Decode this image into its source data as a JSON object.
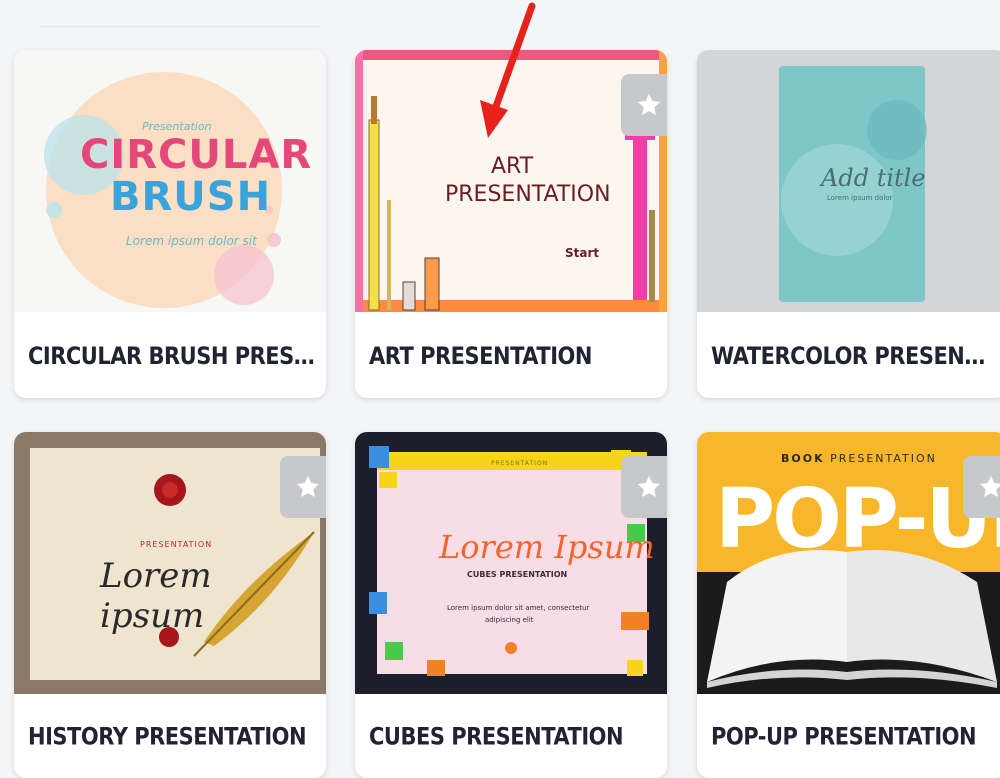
{
  "templates": [
    {
      "title": "CIRCULAR BRUSH PRESENTATI...",
      "favorite": false,
      "thumb": {
        "kicker": "Presentation",
        "line1": "CIRCULAR",
        "line2": "BRUSH",
        "sub": "Lorem ipsum dolor sit"
      }
    },
    {
      "title": "ART PRESENTATION",
      "favorite": true,
      "thumb": {
        "line1": "ART",
        "line2": "PRESENTATION",
        "start": "Start"
      }
    },
    {
      "title": "WATERCOLOR PRESENTATION II",
      "favorite": false,
      "thumb": {
        "heading": "Add title",
        "sub": "Lorem ipsum dolor"
      }
    },
    {
      "title": "HISTORY PRESENTATION",
      "favorite": true,
      "thumb": {
        "kicker": "PRESENTATION",
        "heading": "Lorem ipsum"
      }
    },
    {
      "title": "CUBES PRESENTATION",
      "favorite": true,
      "thumb": {
        "kicker": "PRESENTATION",
        "heading": "Lorem Ipsum",
        "sub": "CUBES PRESENTATION",
        "body1": "Lorem ipsum dolor sit amet, consectetur",
        "body2": "adipiscing elit"
      }
    },
    {
      "title": "POP-UP PRESENTATION",
      "favorite": true,
      "thumb": {
        "kicker_bold": "BOOK",
        "kicker": "PRESENTATION",
        "heading": "POP-UP"
      }
    }
  ],
  "icons": {
    "favorite": "star-icon",
    "annotation": "red-arrow"
  },
  "colors": {
    "title_text": "#1f2430",
    "favorite_bg": "#c6c8cc",
    "arrow": "#e8211c"
  }
}
